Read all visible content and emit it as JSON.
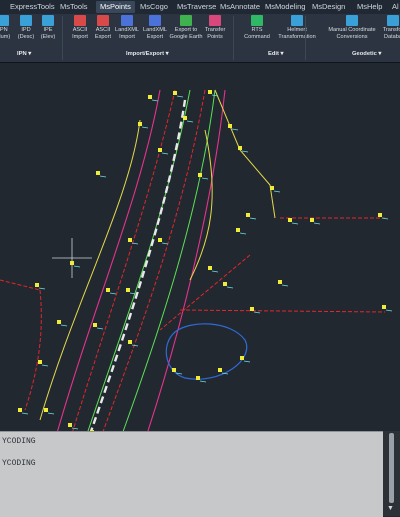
{
  "tabs": [
    "ExpressTools",
    "MsTools",
    "MsPoints",
    "MsCogo",
    "MsTraverse",
    "MsAnnotate",
    "MsModeling",
    "MsDesign",
    "MsHelp",
    "Al"
  ],
  "active_tab": "MsPoints",
  "ribbon": {
    "buttons": [
      {
        "line1": "IPN",
        "line2": "Alum)",
        "color": "#3aa0d8"
      },
      {
        "line1": "IPD",
        "line2": "(Desc)",
        "color": "#3aa0d8"
      },
      {
        "line1": "IPE",
        "line2": "(Elev)",
        "color": "#3aa0d8"
      },
      {
        "line1": "ASCII",
        "line2": "Import",
        "color": "#d84a4a"
      },
      {
        "line1": "ASCII",
        "line2": "Export",
        "color": "#d84a4a"
      },
      {
        "line1": "LandXML",
        "line2": "Import",
        "color": "#4a72d8"
      },
      {
        "line1": "LandXML",
        "line2": "Export",
        "color": "#4a72d8"
      },
      {
        "line1": "Export to",
        "line2": "Google Earth",
        "color": "#3fb24f"
      },
      {
        "line1": "Transfer",
        "line2": "Points",
        "color": "#d8487a"
      },
      {
        "line1": "RTS",
        "line2": "Command",
        "color": "#2fb865"
      },
      {
        "line1": "Helmert",
        "line2": "Transformation",
        "color": "#3aa0d8"
      },
      {
        "line1": "Manual Coordinate",
        "line2": "Conversions",
        "color": "#3aa0d8"
      },
      {
        "line1": "Transfor",
        "line2": "Databa",
        "color": "#3aa0d8"
      }
    ],
    "groups": [
      "IPN",
      "Import/Export",
      "Edit",
      "Geodetic"
    ]
  },
  "command_lines": [
    "YCODING",
    "YCODING"
  ],
  "colors": {
    "pink_line": "#e8328c",
    "yellow_line": "#e5d94a",
    "red_dashed": "#e3262c",
    "green_line": "#5ce155",
    "white_dashed": "#e8e8e8",
    "blue_loop": "#2f6bd8",
    "point_marker": "#f0ec3a"
  }
}
